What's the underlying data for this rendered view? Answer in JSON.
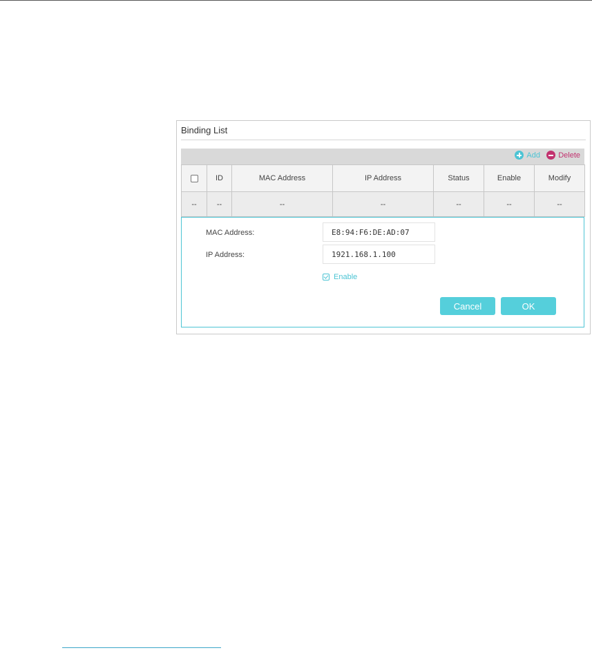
{
  "panel": {
    "title": "Binding List",
    "toolbar": {
      "add_label": "Add",
      "delete_label": "Delete"
    },
    "table": {
      "columns": [
        "ID",
        "MAC Address",
        "IP Address",
        "Status",
        "Enable",
        "Modify"
      ],
      "rows": [
        [
          "--",
          "--",
          "--",
          "--",
          "--",
          "--",
          "--"
        ]
      ]
    },
    "form": {
      "mac_label": "MAC Address:",
      "mac_value": "E8:94:F6:DE:AD:07",
      "ip_label": "IP Address:",
      "ip_value": "1921.168.1.100",
      "enable_label": "Enable",
      "enable_checked": true,
      "cancel_label": "Cancel",
      "ok_label": "OK"
    }
  },
  "colors": {
    "accent": "#4cc4d4",
    "delete": "#c2326f",
    "button": "#55cfdb"
  }
}
